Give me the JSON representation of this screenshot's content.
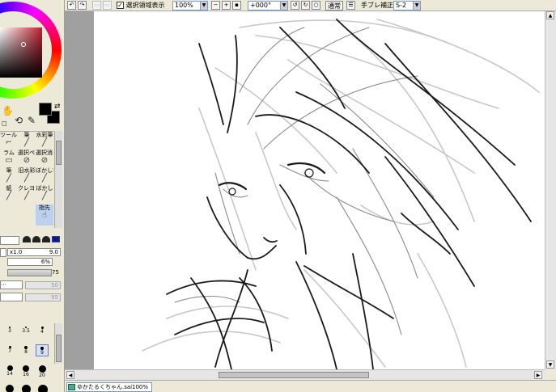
{
  "toolbar": {
    "selection_display_label": "選択領域表示",
    "selection_display_checked": true,
    "zoom": "100%",
    "rotation": "+000°",
    "blend_mode": "通常",
    "stabilizer_label": "手ブレ補正",
    "stabilizer_value": "S-2"
  },
  "brush_tools": [
    {
      "label": "ツール1"
    },
    {
      "label": "筆"
    },
    {
      "label": "水彩筆"
    },
    {
      "label": "ラム"
    },
    {
      "label": "選択ペン"
    },
    {
      "label": "選択消し"
    },
    {
      "label": "筆"
    },
    {
      "label": "旧水彩"
    },
    {
      "label": "ぼかし筆"
    },
    {
      "label": "紙"
    },
    {
      "label": "クレヨン"
    },
    {
      "label": "ぼかし"
    },
    {
      "label": ""
    },
    {
      "label": ""
    },
    {
      "label": "指先"
    }
  ],
  "brush_settings": {
    "size_multiplier": "x1.0",
    "size_value": "9.0",
    "min_size": "6%",
    "density": "75",
    "texture_value": "50",
    "texture2_value": "95"
  },
  "size_presets": [
    {
      "label": "3",
      "d": 2
    },
    {
      "label": "3.5",
      "d": 2
    },
    {
      "label": "4",
      "d": 3
    },
    {
      "label": "7",
      "d": 3
    },
    {
      "label": "8",
      "d": 4
    },
    {
      "label": "9",
      "d": 4
    },
    {
      "label": "14",
      "d": 7
    },
    {
      "label": "16",
      "d": 8
    },
    {
      "label": "20",
      "d": 9
    }
  ],
  "status": {
    "file_name": "ゆかたるくちゃん.sai",
    "file_zoom": "100%"
  },
  "colors": {
    "foreground": "#000000",
    "background": "#000000",
    "selected_color": "#c02030"
  }
}
